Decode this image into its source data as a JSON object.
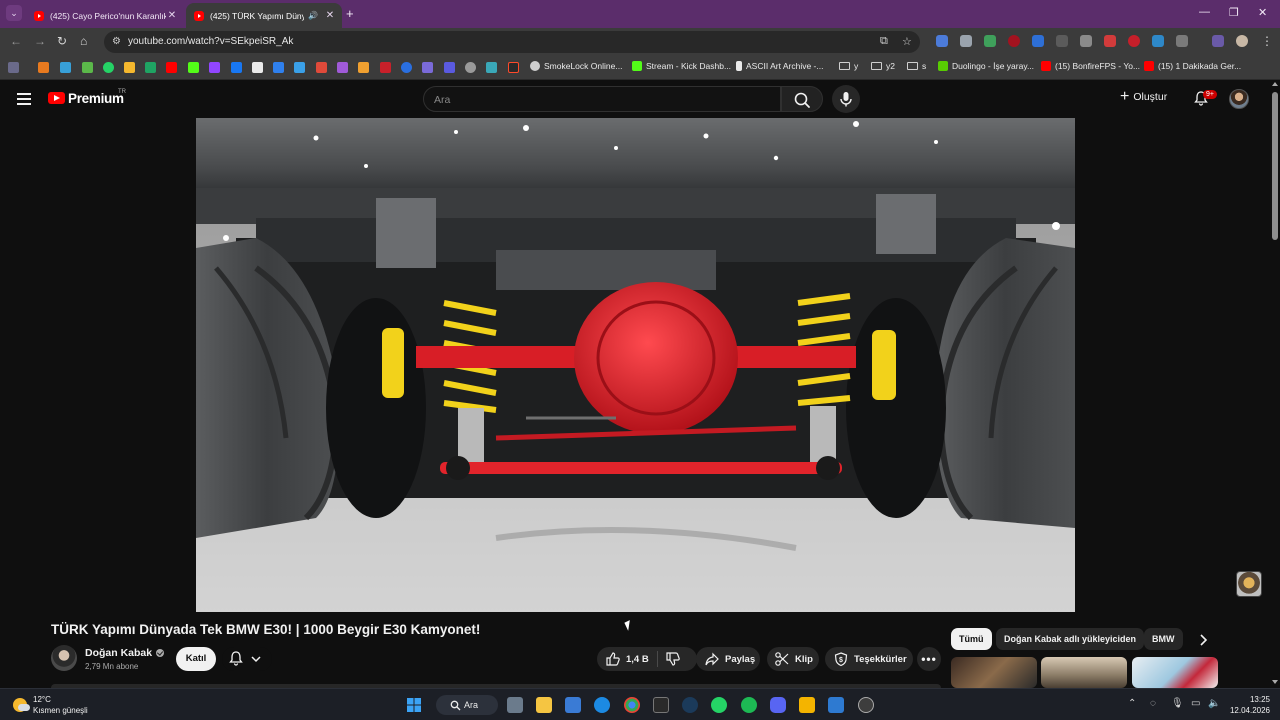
{
  "browser": {
    "tabs": [
      {
        "title": "(425) Cayo Perico'nun Karanlık",
        "active": false
      },
      {
        "title": "(425) TÜRK Yapımı Dünyada",
        "active": true
      }
    ],
    "url": "youtube.com/watch?v=SEkpeiSR_Ak",
    "bookmarks": [
      {
        "label": "SmokeLock Online...",
        "icon": "smokelock-icon"
      },
      {
        "label": "Stream - Kick Dashb...",
        "icon": "kick-icon"
      },
      {
        "label": "ASCII Art Archive -...",
        "icon": "ascii-icon"
      },
      {
        "label": "y",
        "icon": "folder-icon"
      },
      {
        "label": "y2",
        "icon": "folder-icon"
      },
      {
        "label": "s",
        "icon": "folder-icon"
      },
      {
        "label": "Duolingo - İşe yaray...",
        "icon": "duolingo-icon"
      },
      {
        "label": "(15) BonfireFPS - Yo...",
        "icon": "youtube-icon"
      },
      {
        "label": "(15) 1 Dakikada Ger...",
        "icon": "youtube-icon"
      }
    ]
  },
  "youtube": {
    "logo_text": "Premium",
    "country_code": "TR",
    "search_placeholder": "Ara",
    "create_label": "Oluştur",
    "notification_badge": "9+"
  },
  "video": {
    "title": "TÜRK Yapımı Dünyada Tek BMW E30! | 1000 Beygir E30 Kamyonet!",
    "channel": "Doğan Kabak",
    "subscribers": "2,79 Mn abone",
    "join_label": "Katıl",
    "likes": "1,4 B",
    "share_label": "Paylaş",
    "clip_label": "Klip",
    "thanks_label": "Teşekkürler"
  },
  "chips": [
    {
      "label": "Tümü",
      "active": true
    },
    {
      "label": "Doğan Kabak adlı yükleyiciden",
      "active": false
    },
    {
      "label": "BMW",
      "active": false
    }
  ],
  "taskbar": {
    "temperature": "12°C",
    "condition": "Kısmen güneşli",
    "search_label": "Ara",
    "time": "13:25",
    "date": "12.04.2026"
  },
  "colors": {
    "tab_strip": "#5b2d6b",
    "toolbar": "#3b3b3b",
    "youtube_bg": "#0f0f0f",
    "youtube_red": "#ff0000",
    "axle_red": "#e2242b",
    "spring_yellow": "#f2d21b"
  }
}
